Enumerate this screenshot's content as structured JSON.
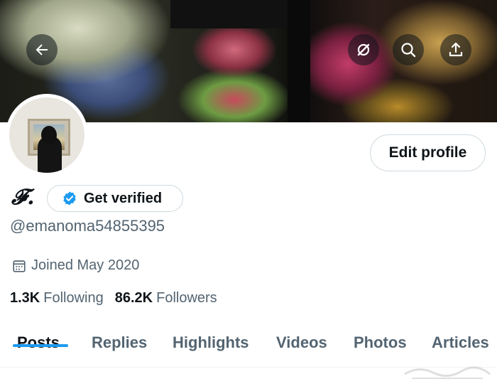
{
  "header": {
    "back_icon": "arrow-left-icon",
    "grok_icon": "grok-icon",
    "search_icon": "search-icon",
    "share_icon": "share-icon"
  },
  "profile": {
    "display_name": "𝓕.",
    "handle": "@emanoma54855395",
    "joined": "Joined May 2020",
    "edit_profile_label": "Edit profile",
    "get_verified_label": "Get verified",
    "following_count": "1.3K",
    "following_label": "Following",
    "followers_count": "86.2K",
    "followers_label": "Followers"
  },
  "tabs": [
    {
      "label": "Posts",
      "active": true
    },
    {
      "label": "Replies",
      "active": false
    },
    {
      "label": "Highlights",
      "active": false
    },
    {
      "label": "Videos",
      "active": false
    },
    {
      "label": "Photos",
      "active": false
    },
    {
      "label": "Articles",
      "active": false
    }
  ],
  "colors": {
    "accent": "#1d9bf0",
    "text_primary": "#0f1419",
    "text_secondary": "#536471",
    "border": "#cfd9de"
  }
}
